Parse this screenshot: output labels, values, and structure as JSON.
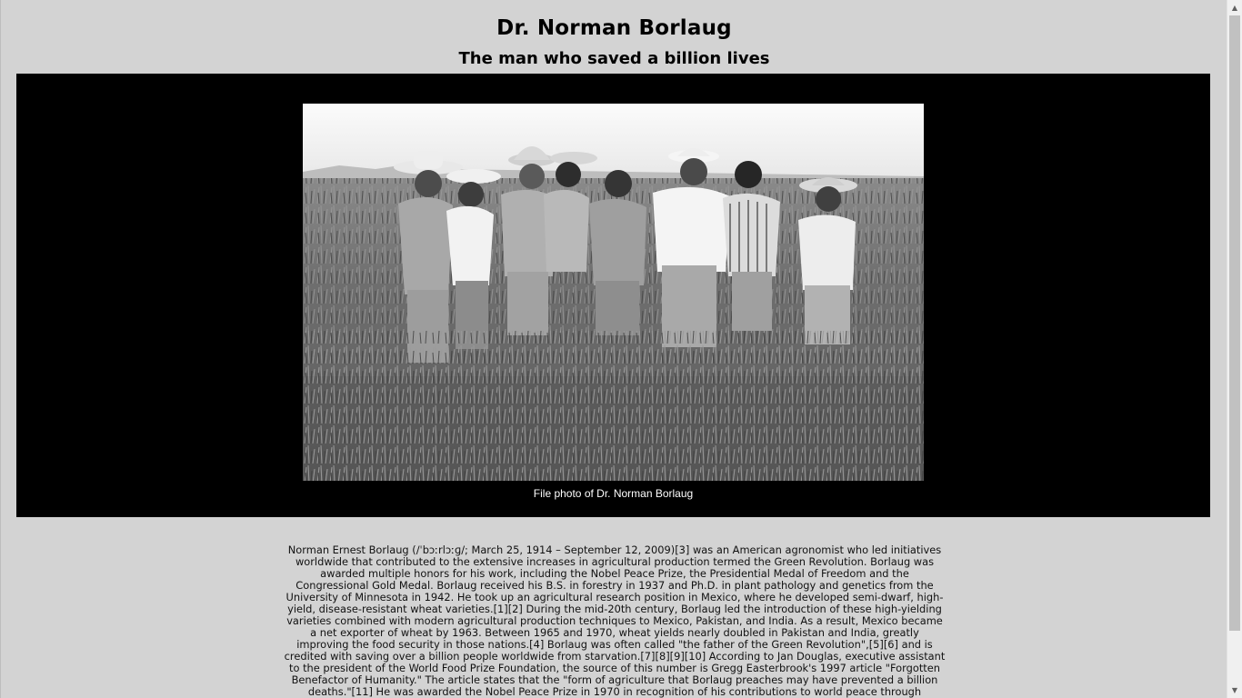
{
  "header": {
    "title": "Dr. Norman Borlaug",
    "subtitle": "The man who saved a billion lives"
  },
  "figure": {
    "image_alt": "Black and white photo of Dr. Norman Borlaug with colleagues in a wheat field",
    "caption": "File photo of Dr. Norman Borlaug"
  },
  "article": {
    "text": "Norman Ernest Borlaug (/ˈbɔːrlɔːɡ/; March 25, 1914 – September 12, 2009)[3] was an American agronomist who led initiatives worldwide that contributed to the extensive increases in agricultural production termed the Green Revolution. Borlaug was awarded multiple honors for his work, including the Nobel Peace Prize, the Presidential Medal of Freedom and the Congressional Gold Medal. Borlaug received his B.S. in forestry in 1937 and Ph.D. in plant pathology and genetics from the University of Minnesota in 1942. He took up an agricultural research position in Mexico, where he developed semi-dwarf, high-yield, disease-resistant wheat varieties.[1][2] During the mid-20th century, Borlaug led the introduction of these high-yielding varieties combined with modern agricultural production techniques to Mexico, Pakistan, and India. As a result, Mexico became a net exporter of wheat by 1963. Between 1965 and 1970, wheat yields nearly doubled in Pakistan and India, greatly improving the food security in those nations.[4] Borlaug was often called \"the father of the Green Revolution\",[5][6] and is credited with saving over a billion people worldwide from starvation.[7][8][9][10] According to Jan Douglas, executive assistant to the president of the World Food Prize Foundation, the source of this number is Gregg Easterbrook's 1997 article \"Forgotten Benefactor of Humanity.\" The article states that the \"form of agriculture that Borlaug preaches may have prevented a billion deaths.\"[11] He was awarded the Nobel Peace Prize in 1970 in recognition of his contributions to world peace through increasing food supply. Later in his life, he helped apply these methods of increasing food production in Asia"
  },
  "scrollbar": {
    "up_icon": "scroll-up-arrow-icon",
    "down_icon": "scroll-down-arrow-icon",
    "position": 0
  }
}
